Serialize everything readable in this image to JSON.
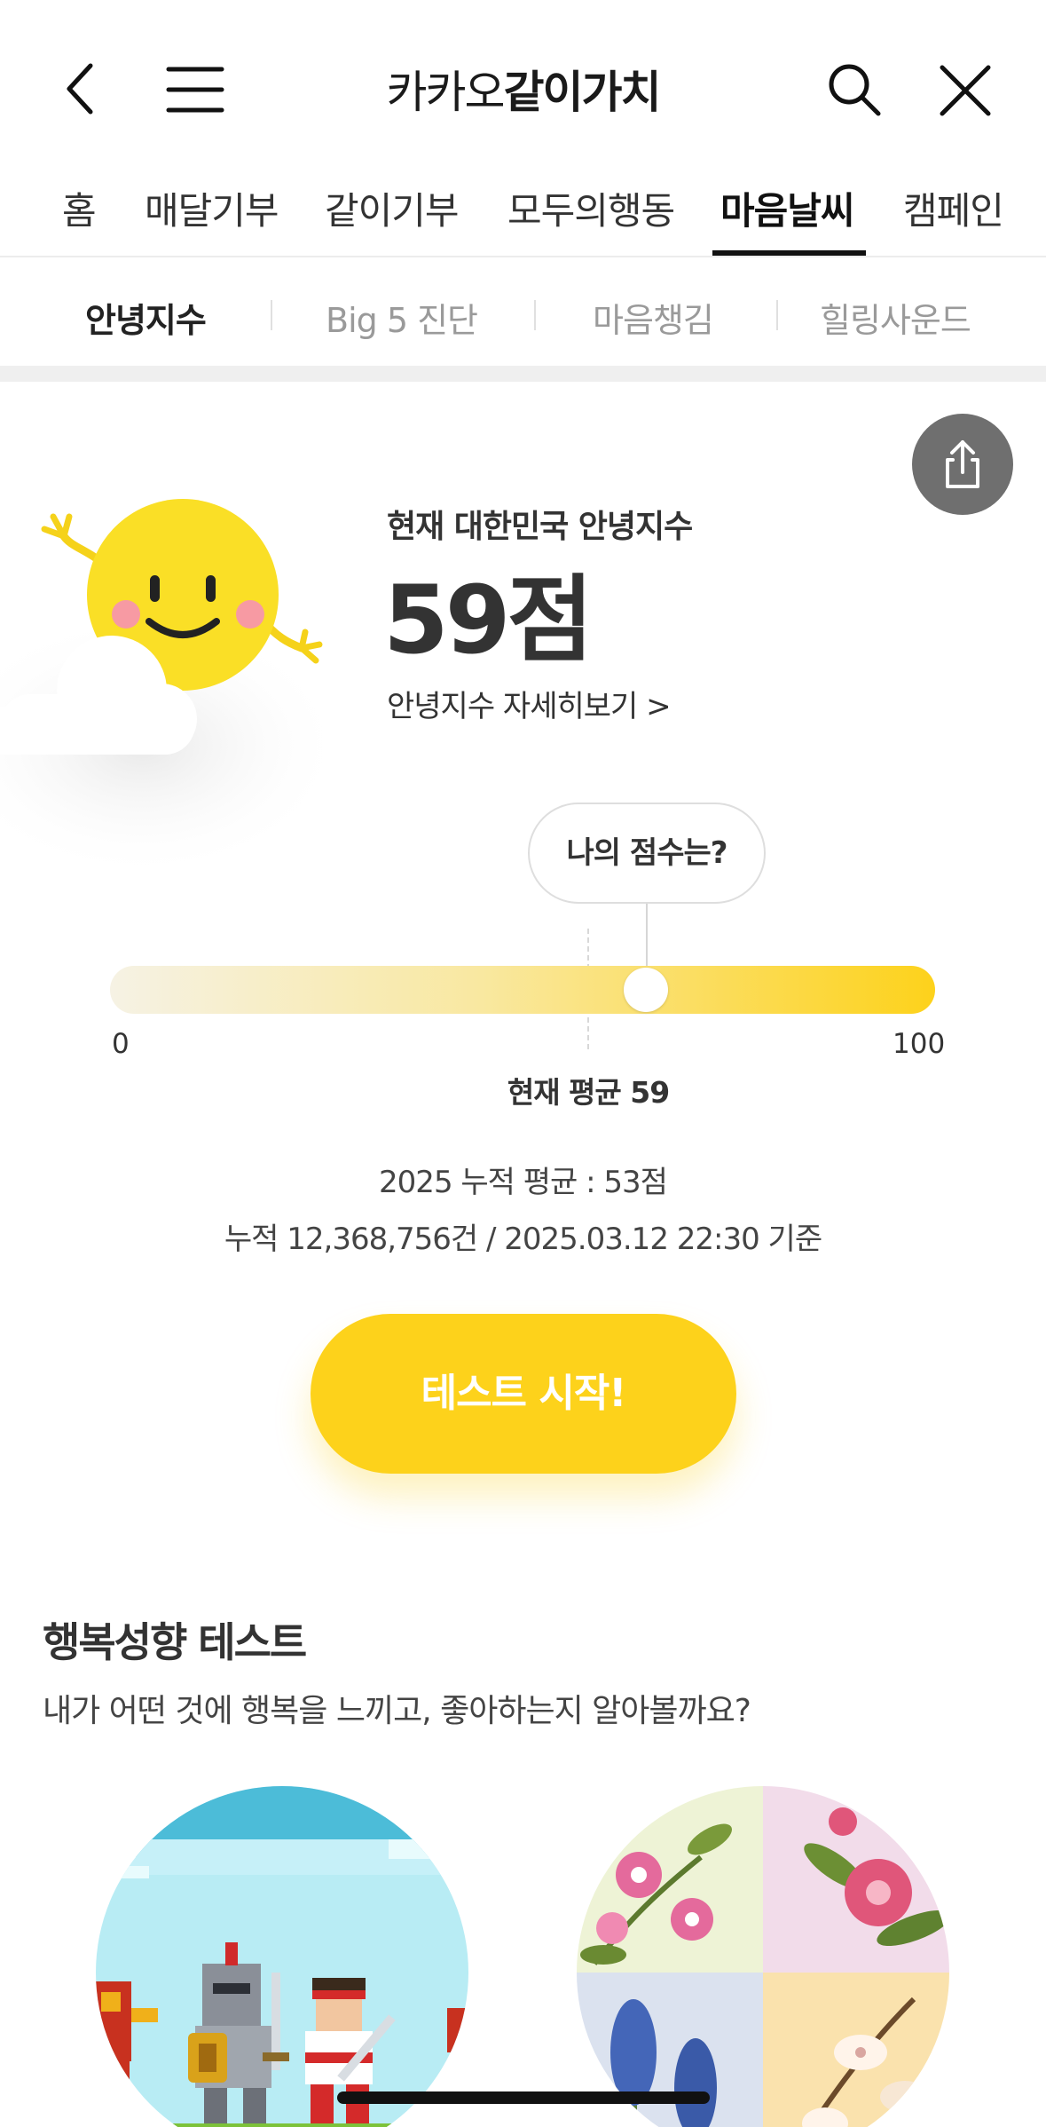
{
  "appbar": {
    "title_light": "카카오",
    "title_bold": "같이가치",
    "icons": [
      "back-arrow-icon",
      "hamburger-menu-icon",
      "search-icon",
      "close-icon"
    ]
  },
  "tabs": [
    "홈",
    "매달기부",
    "같이기부",
    "모두의행동",
    "마음날씨",
    "캠페인"
  ],
  "active_tab": "마음날씨",
  "subtabs": [
    "안녕지수",
    "Big 5 진단",
    "마음챙김",
    "힐링사운드"
  ],
  "active_subtab": "안녕지수",
  "score": {
    "label": "현재 대한민국 안녕지수",
    "value": "59점",
    "detail_link": "안녕지수 자세히보기 >"
  },
  "gauge": {
    "bubble": "나의 점수는?",
    "min": "0",
    "max": "100",
    "current_avg": 59,
    "avg_label": "현재 평균 59"
  },
  "cumulative": {
    "line1": "2025 누적 평균 : 53점",
    "line2": "누적 12,368,756건 / 2025.03.12 22:30 기준"
  },
  "start_button": "테스트 시작!",
  "section": {
    "title": "행복성향 테스트",
    "desc": "내가 어떤 것에 행복을 느끼고, 좋아하는지 알아볼까요?"
  },
  "colors": {
    "brand_yellow": "#fdd21b",
    "share_button": "#6f6f6f",
    "text_dark": "#333333"
  }
}
